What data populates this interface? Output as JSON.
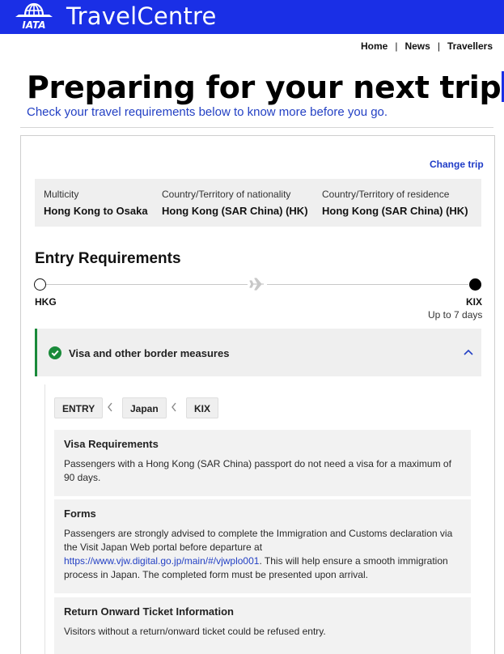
{
  "header": {
    "brand": "TravelCentre",
    "logo_text": "IATA",
    "logo_icon": "iata-globe-logo"
  },
  "nav": {
    "items": [
      "Home",
      "News",
      "Travellers"
    ]
  },
  "hero": {
    "headline": "Preparing for your next trip?",
    "subline": "Check your travel requirements below to know more before you go."
  },
  "trip": {
    "change_label": "Change trip",
    "summary": [
      {
        "label": "Multicity",
        "value": "Hong Kong to Osaka"
      },
      {
        "label": "Country/Territory of nationality",
        "value": "Hong Kong (SAR China) (HK)"
      },
      {
        "label": "Country/Territory of residence",
        "value": "Hong Kong (SAR China) (HK)"
      }
    ]
  },
  "entry": {
    "title": "Entry Requirements",
    "origin_code": "HKG",
    "destination_code": "KIX",
    "duration": "Up to 7 days"
  },
  "accordion": {
    "title": "Visa and other border measures",
    "status_color": "#1a8a3a",
    "expanded": true
  },
  "breadcrumb": [
    "ENTRY",
    "Japan",
    "KIX"
  ],
  "sections": [
    {
      "title": "Visa Requirements",
      "body": "Passengers with a Hong Kong (SAR China) passport do not need a visa for a maximum of 90 days."
    },
    {
      "title": "Forms",
      "body_before": "Passengers are strongly advised to complete the Immigration and Customs declaration via the Visit Japan Web portal before departure at",
      "link": "https://www.vjw.digital.go.jp/main/#/vjwplo001",
      "body_after": ". This will help ensure a smooth immigration process in Japan. The completed form must be presented upon arrival."
    },
    {
      "title": "Return Onward Ticket Information",
      "body": "Visitors without a return/onward ticket could be refused entry."
    }
  ],
  "colors": {
    "brand_blue": "#1a2fe6",
    "link_blue": "#2340c4",
    "panel_gray": "#efefef"
  }
}
